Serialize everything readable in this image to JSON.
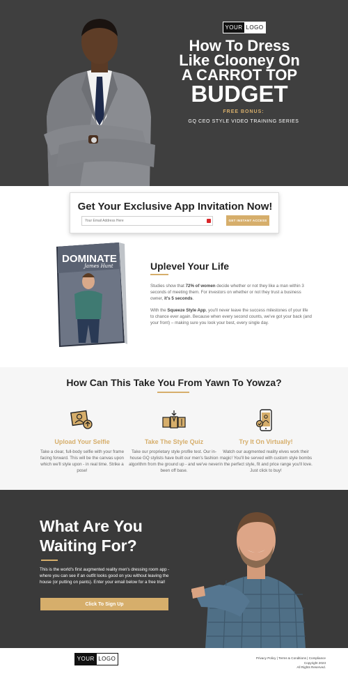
{
  "colors": {
    "accent": "#d6ae6b",
    "hero_bg": "#3f3f3f",
    "cta_bg": "#3a3a3a",
    "badge_red": "#d9262a"
  },
  "logo": {
    "part1": "YOUR",
    "part2": "LOGO"
  },
  "hero": {
    "title_line1": "How To Dress",
    "title_line2": "Like Clooney On",
    "title_line3": "A CARROT TOP",
    "title_line4": "BUDGET",
    "bonus_label": "FREE BONUS:",
    "bonus_text": "GQ CEO STYLE VIDEO TRAINING SERIES"
  },
  "invite": {
    "title": "Get Your Exclusive App Invitation Now!",
    "email_placeholder": "Your Email Address Here",
    "button_label": "GET INSTANT ACCESS"
  },
  "book": {
    "title": "DOMINATE",
    "author": "James Hunt"
  },
  "uplevel": {
    "title": "Uplevel Your Life",
    "p1_before": "Studies show that ",
    "p1_bold1": "72% of women",
    "p1_mid": " decide whether or not they like a man within 3 seconds of meeting them.  For investors on whether or not they trust a business owner, ",
    "p1_bold2": "it's 5 seconds",
    "p1_end": ".",
    "p2_before": "With the ",
    "p2_bold": "Squeeze Style App",
    "p2_after": ", you'll never leave the success milestones of your life to chance ever again.  Because when every second counts, we've got your back (and your front) – making sure you look your best, every single day."
  },
  "how": {
    "title": "How Can This Take You From Yawn To Yowza?",
    "features": [
      {
        "icon": "selfie-upload-icon",
        "title": "Upload Your Selfie",
        "desc": "Take a clear, full-body selfie with your frame facing forward.  This will be the canvas upon which we'll style upon - in real time.  Strike a pose!"
      },
      {
        "icon": "style-quiz-icon",
        "title": "Take The Style Quiz",
        "desc": "Take our proprietary style profile test.  Our in-house GQ stylists have built our men's fashion algorithm from the ground up - and we've never been off base."
      },
      {
        "icon": "phone-try-on-icon",
        "title": "Try It On Virtually!",
        "desc": "Watch our augmented reality elves work their magic! You'll be served with custom style bombs in the perfect style, fit and price range you'll love. Just click to buy!"
      }
    ]
  },
  "cta": {
    "title_line1": "What Are You",
    "title_line2": "Waiting For?",
    "text": "This is the world's first augmented reality men's dressing room app - where you can see if an outfit looks good on you without leaving the house (or putting on pants). Enter your email below for a free trial!",
    "button_label": "Click To Sign Up"
  },
  "footer": {
    "link1": "Privacy Policy",
    "sep": " | ",
    "link2": "Terms & Conditions",
    "link3": "Compliance",
    "copyright": "Copyright 2023",
    "rights": "All Rights Reserved."
  }
}
